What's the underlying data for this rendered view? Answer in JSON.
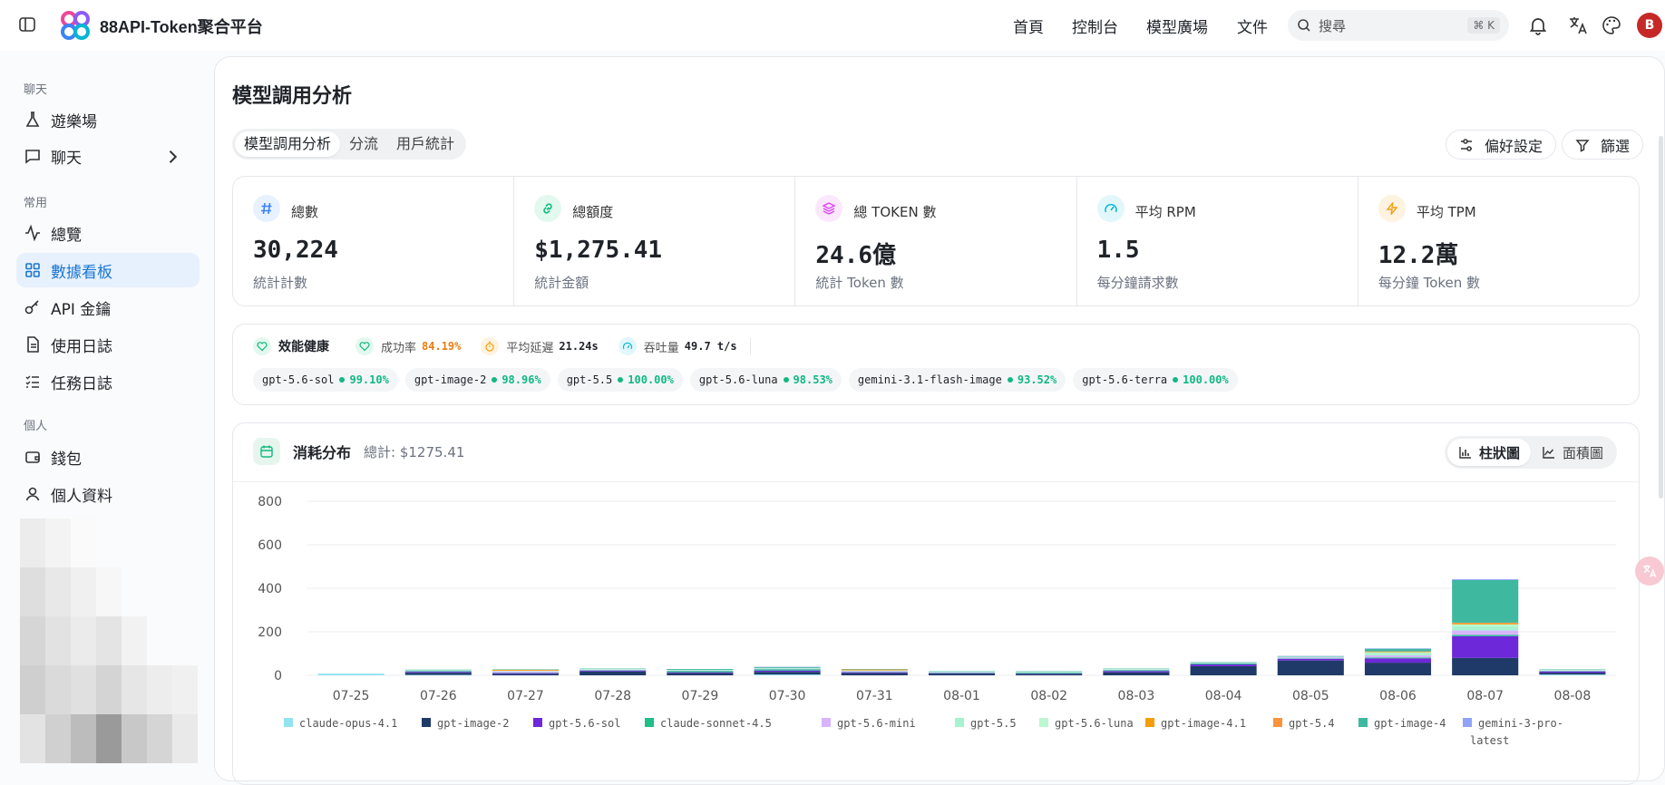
{
  "app": {
    "title": "88API-Token聚合平台"
  },
  "nav": [
    "首頁",
    "控制台",
    "模型廣場",
    "文件"
  ],
  "search": {
    "placeholder": "搜尋",
    "shortcut": "⌘ K"
  },
  "user": {
    "avatar_letter": "B"
  },
  "sidebar": {
    "sections": [
      {
        "label": "聊天",
        "items": [
          {
            "label": "遊樂場",
            "icon": "flask-icon"
          },
          {
            "label": "聊天",
            "icon": "chat-icon"
          }
        ]
      },
      {
        "label": "常用",
        "items": [
          {
            "label": "總覽",
            "icon": "activity-icon"
          },
          {
            "label": "數據看板",
            "icon": "grid-icon",
            "active": true
          },
          {
            "label": "API 金鑰",
            "icon": "key-icon"
          },
          {
            "label": "使用日誌",
            "icon": "document-icon"
          },
          {
            "label": "任務日誌",
            "icon": "list-icon"
          }
        ]
      },
      {
        "label": "個人",
        "items": [
          {
            "label": "錢包",
            "icon": "wallet-icon"
          },
          {
            "label": "個人資料",
            "icon": "user-icon"
          }
        ]
      }
    ]
  },
  "page": {
    "title": "模型調用分析",
    "tabs": [
      "模型調用分析",
      "分流",
      "用戶統計"
    ],
    "pref_button": "偏好設定",
    "filter_button": "篩選"
  },
  "stats": [
    {
      "label": "總數",
      "value": "30,224",
      "sub": "統計計數",
      "icon": "hash-icon",
      "color": "#3b82f6"
    },
    {
      "label": "總額度",
      "value": "$1,275.41",
      "sub": "統計金額",
      "icon": "link-icon",
      "color": "#10b981"
    },
    {
      "label": "總 TOKEN 數",
      "value": "24.6億",
      "sub": "統計 Token 數",
      "icon": "layers-icon",
      "color": "#d946ef"
    },
    {
      "label": "平均 RPM",
      "value": "1.5",
      "sub": "每分鐘請求數",
      "icon": "gauge-icon",
      "color": "#06b6d4"
    },
    {
      "label": "平均 TPM",
      "value": "12.2萬",
      "sub": "每分鐘 Token 數",
      "icon": "zap-icon",
      "color": "#f59e0b"
    }
  ],
  "health": {
    "title": "效能健康",
    "success_label": "成功率",
    "success_value": "84.19%",
    "latency_label": "平均延遲",
    "latency_value": "21.24s",
    "throughput_label": "吞吐量",
    "throughput_value": "49.7 t/s",
    "models": [
      {
        "name": "gpt-5.6-sol",
        "pct": "99.10%"
      },
      {
        "name": "gpt-image-2",
        "pct": "98.96%"
      },
      {
        "name": "gpt-5.5",
        "pct": "100.00%"
      },
      {
        "name": "gpt-5.6-luna",
        "pct": "98.53%"
      },
      {
        "name": "gemini-3.1-flash-image",
        "pct": "93.52%"
      },
      {
        "name": "gpt-5.6-terra",
        "pct": "100.00%"
      }
    ]
  },
  "consumption": {
    "title": "消耗分布",
    "total": "總計: $1275.41",
    "bar_label": "柱狀圖",
    "area_label": "面積圖"
  },
  "chart_data": {
    "type": "bar",
    "stacked": true,
    "categories": [
      "07-25",
      "07-26",
      "07-27",
      "07-28",
      "07-29",
      "07-30",
      "07-31",
      "08-01",
      "08-02",
      "08-03",
      "08-04",
      "08-05",
      "08-06",
      "08-07",
      "08-08"
    ],
    "ylim": [
      0,
      800
    ],
    "yticks": [
      0,
      200,
      400,
      600,
      800
    ],
    "grid": true,
    "legend_position": "bottom",
    "series": [
      {
        "name": "claude-opus-4.1",
        "color": "#93e3f2",
        "values": [
          8,
          2,
          0,
          0,
          0,
          4,
          0,
          0,
          0,
          0,
          0,
          0,
          0,
          0,
          4
        ]
      },
      {
        "name": "gpt-image-2",
        "color": "#1f3a68",
        "values": [
          0,
          10,
          6,
          18,
          10,
          12,
          10,
          8,
          6,
          14,
          42,
          68,
          58,
          80,
          8
        ]
      },
      {
        "name": "gpt-5.6-sol",
        "color": "#6d28d9",
        "values": [
          0,
          4,
          4,
          4,
          4,
          6,
          4,
          2,
          2,
          6,
          8,
          8,
          20,
          100,
          6
        ]
      },
      {
        "name": "claude-sonnet-4.5",
        "color": "#1fbf86",
        "values": [
          0,
          3,
          2,
          2,
          6,
          6,
          2,
          2,
          4,
          4,
          4,
          2,
          4,
          6,
          2
        ]
      },
      {
        "name": "gpt-5.6-mini",
        "color": "#d8b4fe",
        "values": [
          0,
          2,
          6,
          2,
          2,
          2,
          4,
          2,
          2,
          2,
          2,
          4,
          10,
          20,
          2
        ]
      },
      {
        "name": "gpt-5.5",
        "color": "#a7f3d0",
        "values": [
          0,
          2,
          2,
          2,
          2,
          2,
          2,
          2,
          2,
          2,
          2,
          2,
          10,
          20,
          2
        ]
      },
      {
        "name": "gpt-5.6-luna",
        "color": "#bbf7d0",
        "values": [
          0,
          1,
          1,
          1,
          1,
          1,
          1,
          1,
          1,
          1,
          1,
          1,
          4,
          8,
          1
        ]
      },
      {
        "name": "gpt-image-4.1",
        "color": "#f59e0b",
        "values": [
          0,
          0,
          2,
          0,
          0,
          0,
          2,
          0,
          0,
          0,
          0,
          0,
          2,
          4,
          0
        ]
      },
      {
        "name": "gpt-5.4",
        "color": "#fb923c",
        "values": [
          0,
          0,
          2,
          0,
          0,
          0,
          2,
          0,
          0,
          0,
          0,
          0,
          2,
          4,
          0
        ]
      },
      {
        "name": "gpt-image-4",
        "color": "#3fb8a0",
        "values": [
          0,
          2,
          2,
          2,
          4,
          4,
          2,
          2,
          2,
          2,
          2,
          2,
          12,
          196,
          2
        ]
      },
      {
        "name": "gemini-3-pro-latest",
        "color": "#8fa3f7",
        "values": [
          0,
          0,
          0,
          0,
          0,
          2,
          0,
          0,
          0,
          0,
          0,
          2,
          2,
          4,
          0
        ]
      }
    ]
  }
}
